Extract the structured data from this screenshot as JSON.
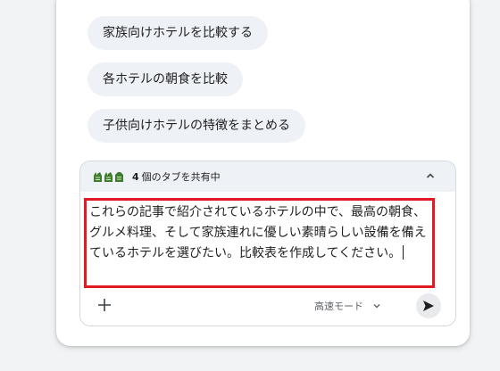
{
  "suggestions": [
    {
      "label": "家族向けホテルを比較する"
    },
    {
      "label": "各ホテルの朝食を比較"
    },
    {
      "label": "子供向けホテルの特徴をまとめる"
    }
  ],
  "tab_share": {
    "count": "4",
    "label": "個のタブを共有中",
    "icons": [
      "tab-favicon-icon",
      "tab-favicon-icon",
      "tab-favicon-icon"
    ],
    "icon_color": "#3e7d2a"
  },
  "composer": {
    "prompt_text": "これらの記事で紹介されているホテルの中で、最高の朝食、グルメ料理、そして家族連れに優しい素晴らしい設備を備えているホテルを選びたい。比較表を作成してください。",
    "mode_label": "高速モード",
    "highlight_color": "#e01b24"
  }
}
